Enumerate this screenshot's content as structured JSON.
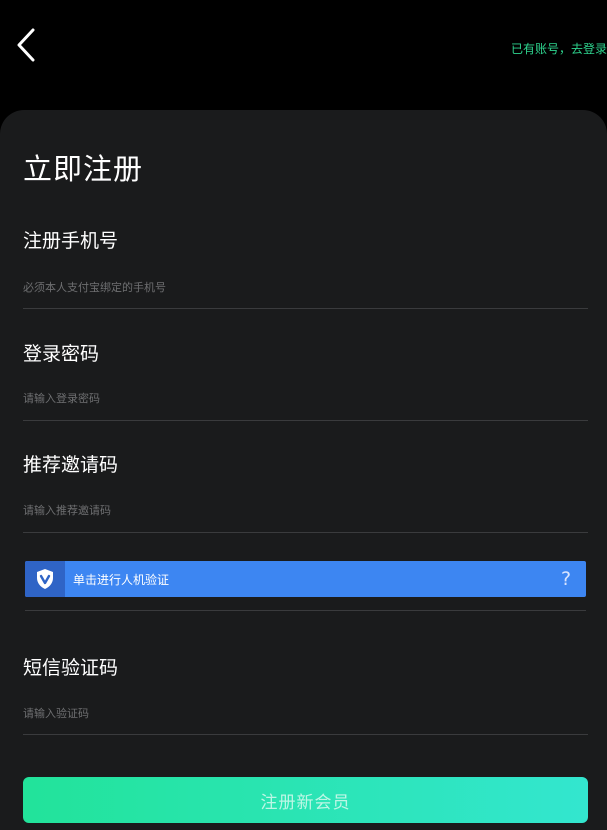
{
  "header": {
    "back_icon": "chevron-left-icon",
    "login_link": "已有账号，去登录"
  },
  "form": {
    "title": "立即注册",
    "fields": [
      {
        "label": "注册手机号",
        "placeholder": "必须本人支付宝绑定的手机号",
        "value": ""
      },
      {
        "label": "登录密码",
        "placeholder": "请输入登录密码",
        "value": ""
      },
      {
        "label": "推荐邀请码",
        "placeholder": "请输入推荐邀请码",
        "value": ""
      }
    ],
    "captcha": {
      "text": "单击进行人机验证",
      "icon": "shield-v-icon",
      "help": "?"
    },
    "sms": {
      "label": "短信验证码",
      "placeholder": "请输入验证码",
      "value": ""
    },
    "submit_label": "注册新会员"
  },
  "colors": {
    "background": "#000000",
    "card": "#1a1b1c",
    "accent_green": "#2ed58f",
    "captcha_blue": "#3d86f2",
    "captcha_icon_bg": "#2f64c6",
    "button_start": "#22e39a",
    "button_end": "#33e6cf"
  }
}
